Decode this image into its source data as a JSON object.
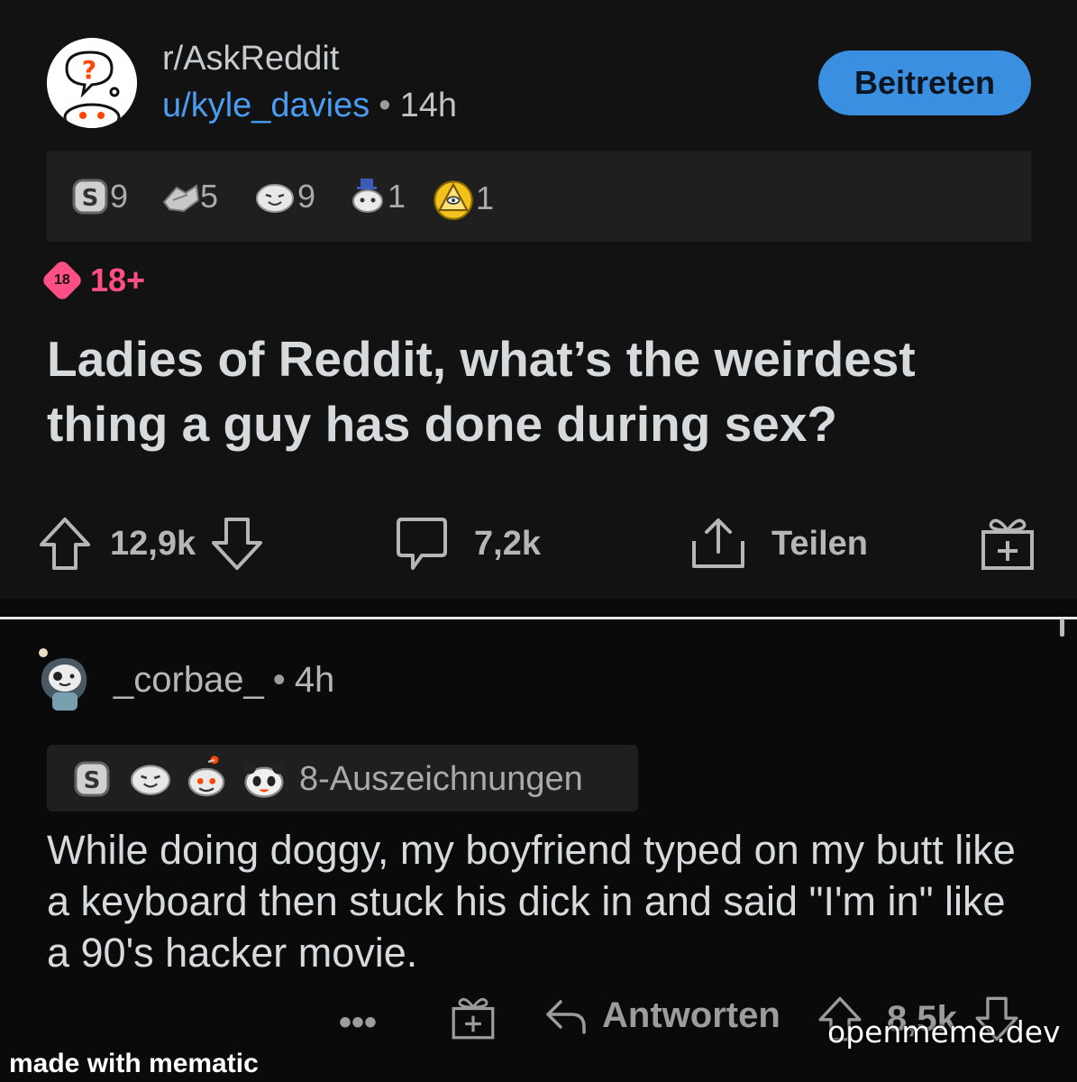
{
  "post": {
    "subreddit": "r/AskReddit",
    "author": "u/kyle_davies",
    "separator": "•",
    "time": "14h",
    "join_label": "Beitreten",
    "awards": [
      {
        "icon": "silver-award-icon",
        "count": "9"
      },
      {
        "icon": "handshake-award-icon",
        "count": "5"
      },
      {
        "icon": "laughing-award-icon",
        "count": "9"
      },
      {
        "icon": "snoo-hat-award-icon",
        "count": "1"
      },
      {
        "icon": "pyramid-eye-award-icon",
        "count": "1"
      }
    ],
    "nsfw_badge": "18",
    "nsfw_label": "18+",
    "title": "Ladies of Reddit, what’s the weirdest thing a guy has done during sex?",
    "votes": "12,9k",
    "comments": "7,2k",
    "share_label": "Teilen"
  },
  "comment": {
    "author": "_corbae_",
    "separator": "•",
    "time": "4h",
    "awards_label": "8-Auszeichnungen",
    "award_icons": [
      "silver-award-icon",
      "laughing-award-icon",
      "snoo-award-icon",
      "panda-award-icon"
    ],
    "body": "While doing doggy, my boyfriend typed on my butt like a keyboard then stuck his dick in and said \"I'm in\" like a 90's hacker movie.",
    "more_label": "•••",
    "reply_label": "Antworten",
    "votes": "8,5k"
  },
  "watermarks": {
    "left": "made with mematic",
    "right": "openmeme.dev"
  },
  "colors": {
    "background": "#121212",
    "link_blue": "#4a9cf0",
    "button_blue": "#3a8fe0",
    "nsfw_pink": "#ff4f85"
  }
}
